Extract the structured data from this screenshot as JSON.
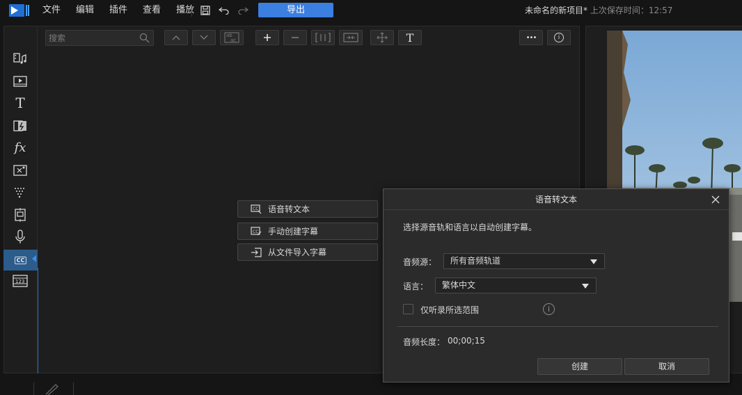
{
  "app": {
    "project_title": "未命名的新项目*",
    "last_saved_label": "上次保存时间：12:57"
  },
  "menu": {
    "items": [
      "文件",
      "编辑",
      "插件",
      "查看",
      "播放"
    ],
    "export_label": "导出"
  },
  "search": {
    "placeholder": "搜索"
  },
  "toolbar": {
    "text_tool_label": "T",
    "more_label": "•••",
    "info_label": "i"
  },
  "sidebar": {
    "active_item": "cc",
    "cc_label": "CC",
    "title_tool_label": "T",
    "fx_label": "fx",
    "numbers_label": "123"
  },
  "subtitle_menu": {
    "speech_to_text": "语音转文本",
    "manual_create": "手动创建字幕",
    "import_from_file": "从文件导入字幕"
  },
  "dialog": {
    "title": "语音转文本",
    "description": "选择源音轨和语言以自动创建字幕。",
    "audio_source_label": "音频源：",
    "audio_source_value": "所有音频轨道",
    "language_label": "语言：",
    "language_value": "繁体中文",
    "selection_only_label": "仅听录所选范围",
    "audio_length_label": "音频长度：",
    "audio_length_value": "00;00;15",
    "create_button": "创建",
    "cancel_button": "取消"
  },
  "colors": {
    "accent": "#3b7fe0",
    "active_sidebar": "#2c5c8c",
    "background": "#1e1e1e"
  }
}
